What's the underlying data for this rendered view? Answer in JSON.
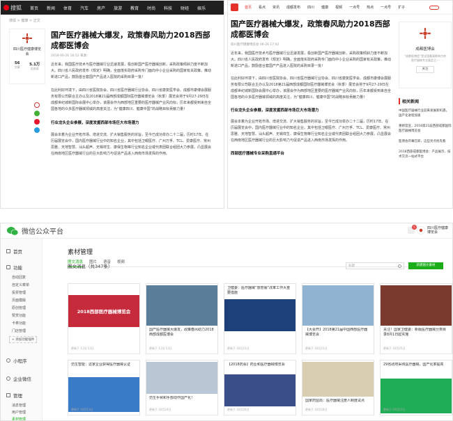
{
  "site1": {
    "logo_text": "搜狐",
    "nav": [
      "首页",
      "新闻",
      "体育",
      "汽车",
      "房产",
      "旅游",
      "教育",
      "时尚",
      "科技",
      "财经",
      "娱乐"
    ],
    "breadcrumb": "搜狐 > 健康 > 正文",
    "article_title": "国产医疗器械大爆发，政策春风助力2018西部成都医博会",
    "meta": "2018-06-26 16:52  来源：",
    "author_name": "四川医疗健康博览会",
    "stats": [
      {
        "v": "56",
        "l": "文章"
      },
      {
        "v": "5.1万",
        "l": "总阅读"
      }
    ],
    "paragraphs": [
      "近年来，我国医疗技术与医疗器械行业迅速发展，极创新国产医疗器械创新，采购政策倾斜力度不断加大。四川省人民政府发布《规定》明确，全面落实政府采购专门面向中小企业采购的国家有关政策，推动新进口产品，鼓励首台套国产产品进入医院的采购目录一批！",
      "在此利好环境下，由四川省医院协会、四川省医疗器械行业协会、四川省康复医学会、成都市康博会展服务有限公司联合主办以及2018第21届西部成都国际医疗器械博览会（秋季）展览会将于9月27-29日在成都世纪城新国际会展中心举办，该展会作为西部地区重要的医疗器械产业风向标，历年来都受到来自全国各地的众多医疗器械领域的高度关注，为“健康四川、健康中国”的战略目标贡献力量！"
    ],
    "subheading": "行业龙头企业参展，深度发掘西部市场巨大市场潜力",
    "paragraph3": "展会本着为企业开拓市场、增进交流、扩大销售服务的宗旨，至今已成功举办二十二届，历时17年。在历届展览会中，国内医疗器械行业中的知名企业，其中包括卫眼医疗、广州万孚、TCL、爱康医疗、常州思雅、天地智慧、汕头超声、无锡祥生、康保生物等行业知名企业或代表团联合组团大力参展，凸显展会在西南地区医疗器械行业的巨大影响力与促进产品进入西南市场发挥的作用。"
  },
  "site2": {
    "nav": [
      "首页",
      "看点",
      "资讯",
      "成都发布",
      "四川",
      "健康",
      "视频",
      "一点号",
      "热点",
      "一点号",
      "扩子"
    ],
    "article_title": "国产医疗器械大爆发，政策春风助力2018西部成都医博会",
    "meta": "四川医疗健康博览会  06-26 17:02",
    "paragraphs": [
      "近年来，我国医疗技术与医疗器械行业迅速发展，极创新国产医疗器械创新，采购政策倾斜力度不断加大。四川省人民政府发布《规定》明确，全面落实政府采购专门面向中小企业采购的国家有关政策，推动新进口产品，鼓励首台套国产产品进入医院的采购目录一批！",
      "在此利好环境下，由四川省医院协会、四川省医疗器械行业协会、四川省康复医学会、成都市康博会展服务有限公司联合主办以及2018第21届西部成都国际医疗器械博览会（秋季）展览会将于9月27-29日在成都世纪城新国际会展中心举办，该展会作为西部地区重要的医疗器械产业风向标，历年来都受到来自全国各地的众多医疗器械领域的高度关注，为“健康四川、健康中国”的战略目标贡献力量！"
    ],
    "subheading": "行业龙头企业参展，深度发掘西部市场巨大市场潜力",
    "paragraph3": "展会本着为企业开拓市场、增进交流、扩大销售服务的宗旨，至今已成功举办二十二届，历时17年。在历届展览会中，国内医疗器械行业中的知名企业，其中包括卫眼医疗、广州万孚、TCL、爱康医疗、常州思雅、天地智慧、汕头超声、无锡祥生、康保生物等行业知名企业或代表团联合组团大力参展，凸显展会在西南地区医疗器械行业的巨大影响力与促进产品进入西南市场发挥的作用。",
    "subheading2": "西部医疗器械专业采购直通平台",
    "author_name": "成都医博会",
    "author_desc": "“成都医博会”是全国最具影响力的医疗器械专业展会之一",
    "follow_label": "关注",
    "related_title": "相关新闻",
    "related": [
      "中国医疗器械行业迎来发展新机遇，国产化进程加速",
      "重磅官宣，2018第21届西部成都国际医疗器械博览会",
      "医博会开幕在即，这些亮点抢先看",
      "2018西部成都医博会：产品展示、技术交流一站式平台"
    ]
  },
  "wechat": {
    "platform_name": "微信公众平台",
    "account_name": "四川医疗健康博览会",
    "badge": "5",
    "sidebar": [
      {
        "label": "首页",
        "icon": "home-icon"
      },
      {
        "label": "功能",
        "icon": "function-icon",
        "items": [
          "自动回复",
          "自定义菜单",
          "投票管理",
          "页面模版",
          "原创管理",
          "赞赏功能",
          "卡券功能",
          "门店管理"
        ]
      },
      {
        "label": "+ 添加功能插件",
        "icon": "plugin-icon"
      },
      {
        "label": "小程序",
        "icon": "miniprogram-icon"
      },
      {
        "label": "企业微信",
        "icon": "wework-icon"
      },
      {
        "label": "管理",
        "icon": "manage-icon",
        "items": [
          "消息管理",
          "用户管理",
          "素材管理"
        ]
      }
    ],
    "page_title": "素材管理",
    "tabs": [
      "图文消息",
      "图片",
      "语音",
      "视频"
    ],
    "count_label": "图文消息（共347条）",
    "search_placeholder": "标题",
    "new_button": "新建图文素材",
    "cards": [
      {
        "title": "2018西部医疗器械博览会",
        "meta": "更新于 11月 13日",
        "type": "banner"
      },
      {
        "title": "国产医疗器械大爆发，政策春风助力2018西部成都医博会",
        "meta": "更新于 11月 13日",
        "type": "city"
      },
      {
        "title": "卫健委：医疗器械“放管服”改革工作大重要措施",
        "meta": "更新于 10月31日",
        "type": "conf"
      },
      {
        "title": "【大会开】2018第21届中国西部医疗器械博览会",
        "meta": "更新于 10月31日",
        "type": "lab"
      },
      {
        "title": "关注！国家卫健委：新版医疗器械分类目录8月1日起实施",
        "meta": "更新于 10月25日",
        "type": "people"
      },
      {
        "title": "仿生手臂和手部动作国产化！",
        "meta": "更新于 10月24日",
        "type": "robot"
      },
      {
        "title": "【2018药会】药业和医疗器械博览会",
        "meta": "更新于 10月20日",
        "type": "expo"
      },
      {
        "title": "国家药监局：医疗器械注册人制度试点",
        "meta": "更新于 10月18日",
        "type": "pack"
      },
      {
        "title": "29省政府采购医疗器械，国产化率提高",
        "meta": "更新于 10月15日",
        "type": "policy"
      },
      {
        "title": "仿生智能：这家企业获得医疗器械认证",
        "meta": "更新于 10月11日",
        "type": "blue"
      }
    ]
  }
}
